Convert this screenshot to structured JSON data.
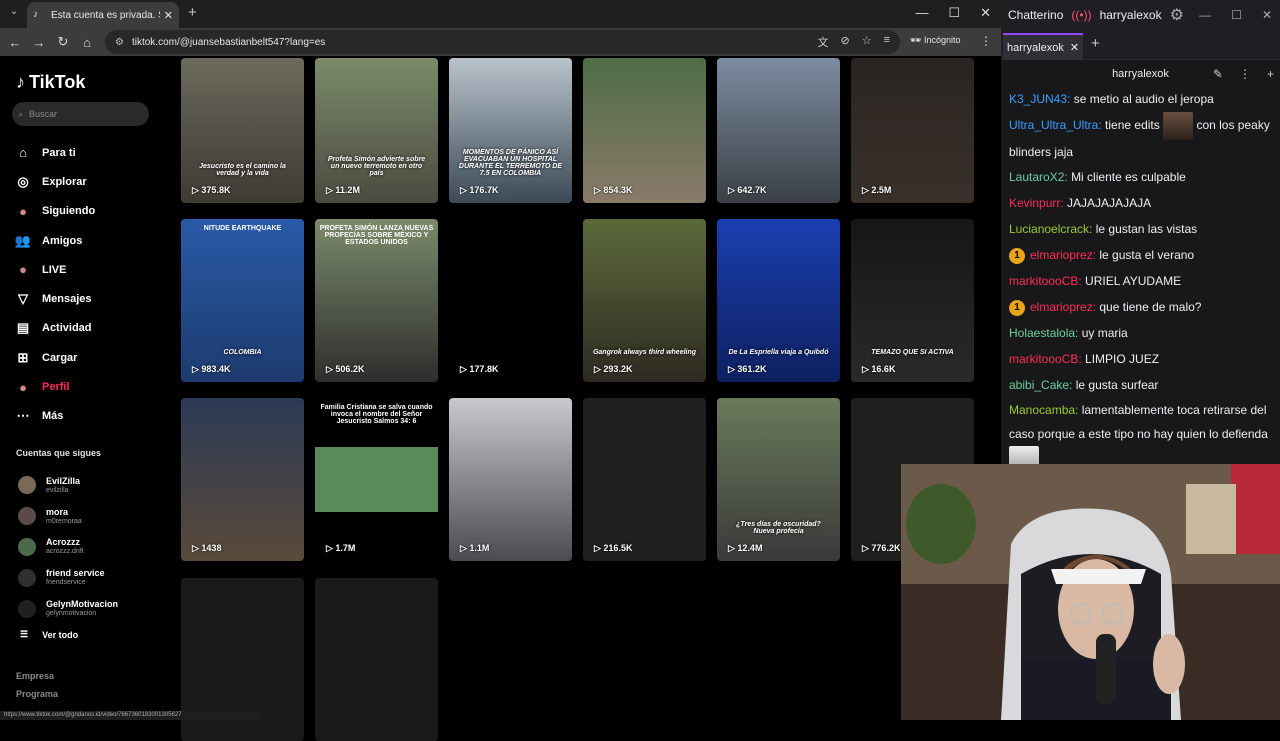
{
  "browser": {
    "tab_title": "Esta cuenta es privada. Sigue es",
    "url": "tiktok.com/@juansebastianbelt547?lang=es",
    "incognito_label": "Incógnito",
    "status_url": "https://www.tiktok.com/@gridanos.id/video/7667360183001305627"
  },
  "tiktok": {
    "logo": "TikTok",
    "search_placeholder": "Buscar",
    "nav": [
      {
        "label": "Para ti",
        "icon": "home-icon"
      },
      {
        "label": "Explorar",
        "icon": "compass-icon"
      },
      {
        "label": "Siguiendo",
        "icon": "following-avatar-icon"
      },
      {
        "label": "Amigos",
        "icon": "friends-icon"
      },
      {
        "label": "LIVE",
        "icon": "live-icon"
      },
      {
        "label": "Mensajes",
        "icon": "paper-plane-icon"
      },
      {
        "label": "Actividad",
        "icon": "activity-icon"
      },
      {
        "label": "Cargar",
        "icon": "upload-icon"
      },
      {
        "label": "Perfil",
        "icon": "profile-avatar-icon"
      },
      {
        "label": "Más",
        "icon": "more-dots-icon"
      }
    ],
    "following_header": "Cuentas que sigues",
    "following": [
      {
        "name": "EvilZilla",
        "handle": "evilzilla",
        "color": "#7a6a55"
      },
      {
        "name": "mora",
        "handle": "m0remoraa",
        "color": "#5a4a48"
      },
      {
        "name": "Acrozzz",
        "handle": "acrozzz.drift",
        "color": "#4a6a4a"
      },
      {
        "name": "friend service",
        "handle": "friendservice",
        "color": "#303030"
      },
      {
        "name": "GelynMotivacion",
        "handle": "gelynmotivacion",
        "color": "#202020"
      }
    ],
    "see_all": "Ver todo",
    "footer": [
      "Empresa",
      "Programa"
    ],
    "videos": [
      {
        "views": "375.8K",
        "caption": "Jesucristo es el camino la verdad y la vida",
        "top": "",
        "bg": "linear-gradient(#6b6a5c,#3e3b33)"
      },
      {
        "views": "11.2M",
        "caption": "Profeta Simón advierte sobre un nuevo terremoto en otro país",
        "top": "",
        "bg": "linear-gradient(#7b8b6a,#4b4a40)"
      },
      {
        "views": "176.7K",
        "caption": "MOMENTOS DE PÁNICO ASÍ EVACUABAN UN HOSPITAL DURANTE EL TERREMOTO DE 7.5 EN COLOMBIA",
        "top": "",
        "bg": "linear-gradient(#b9c3cc,#3c4a57)"
      },
      {
        "views": "854.3K",
        "caption": "",
        "top": "",
        "bg": "linear-gradient(#4e6d45,#8a7a6a)"
      },
      {
        "views": "642.7K",
        "caption": "",
        "top": "",
        "bg": "linear-gradient(#7c8ca0,#3b3f45)"
      },
      {
        "views": "2.5M",
        "caption": "",
        "top": "",
        "bg": "linear-gradient(#2a2522,#3a302a)"
      },
      {
        "views": "983.4K",
        "caption": "COLOMBIA",
        "top": "NITUDE EARTHQUAKE",
        "bg": "linear-gradient(#2a5aa8,#1d3b6e)"
      },
      {
        "views": "506.2K",
        "caption": "",
        "top": "PROFETA SIMÓN LANZA NUEVAS PROFECÍAS SOBRE MÉXICO Y ESTADOS UNIDOS",
        "bg": "linear-gradient(#7a8a6a,#2e2e2e)"
      },
      {
        "views": "177.8K",
        "caption": "",
        "top": "",
        "bg": "#000"
      },
      {
        "views": "293.2K",
        "caption": "Gangrok always third wheeling",
        "top": "",
        "bg": "linear-gradient(#5c6a3a,#2e2a22)"
      },
      {
        "views": "361.2K",
        "caption": "De La Espriella viaja a Quibdó",
        "top": "",
        "bg": "linear-gradient(#1a3fb0,#0e2060)"
      },
      {
        "views": "16.6K",
        "caption": "TEMAZO QUE SI ACTIVA",
        "top": "",
        "bg": "linear-gradient(#161616,#2a2a2a)"
      },
      {
        "views": "1438",
        "caption": "",
        "top": "",
        "bg": "linear-gradient(#2c3a55,#5a4a3a)"
      },
      {
        "views": "1.7M",
        "caption": "",
        "top": "Familia Cristiana se salva cuando invoca el nombre del Señor Jesucristo Salmos 34: 6",
        "bg": "linear-gradient(#000 0 30%,#5a8a5a 30% 70%,#000 70%)"
      },
      {
        "views": "1.1M",
        "caption": "",
        "top": "",
        "bg": "linear-gradient(#c7c9cc,#4a4c50)"
      },
      {
        "views": "216.5K",
        "caption": "",
        "top": "",
        "bg": "#1f1f1f"
      },
      {
        "views": "12.4M",
        "caption": "¿Tres días de oscuridad? Nueva profecía",
        "top": "",
        "bg": "linear-gradient(#6a7a5a,#3a3a3a)"
      },
      {
        "views": "776.2K",
        "caption": "",
        "top": "",
        "bg": "#1f1f1f"
      },
      {
        "views": "",
        "caption": "",
        "top": "",
        "bg": "#1a1a1a"
      },
      {
        "views": "",
        "caption": "",
        "top": "",
        "bg": "#1a1a1a"
      }
    ]
  },
  "chatterino": {
    "app_title": "Chatterino",
    "account": "harryalexok",
    "tab": "harryalexok",
    "channel": "harryalexok",
    "messages": [
      {
        "user": "K3_JUN43:",
        "color": "#3aa0ff",
        "text": "se metio al audio el jeropa",
        "badge": false
      },
      {
        "user": "Ultra_Ultra_Ultra:",
        "color": "#3aa0ff",
        "text": "tiene edits",
        "text2": "con los peaky blinders jaja",
        "badge": false,
        "emote": true
      },
      {
        "user": "LautaroX2:",
        "color": "#6ecf9f",
        "text": "Mi cliente es culpable",
        "badge": false
      },
      {
        "user": "Kevinpurr:",
        "color": "#ff2d55",
        "text": "JAJAJAJAJAJA",
        "badge": false
      },
      {
        "user": "Lucianoelcrack:",
        "color": "#9acd32",
        "text": "le gustan las vistas",
        "badge": false
      },
      {
        "user": "elmarioprez:",
        "color": "#ff2d55",
        "text": "le gusta el verano",
        "badge": true
      },
      {
        "user": "markitoooCB:",
        "color": "#ff2d55",
        "text": "URIEL AYUDAME",
        "badge": false
      },
      {
        "user": "elmarioprez:",
        "color": "#ff2d55",
        "text": "que tiene de malo?",
        "badge": true
      },
      {
        "user": "Holaestalola:",
        "color": "#6ecf9f",
        "text": "uy maria",
        "badge": false
      },
      {
        "user": "markitoooCB:",
        "color": "#ff2d55",
        "text": "LIMPIO JUEZ",
        "badge": false
      },
      {
        "user": "abibi_Cake:",
        "color": "#6ecf9f",
        "text": "le gusta surfear",
        "badge": false
      },
      {
        "user": "Manocamba:",
        "color": "#9acd32",
        "text": "lamentablemente toca retirarse del caso porque a este tipo no hay quien lo defienda",
        "badge": false
      }
    ]
  }
}
